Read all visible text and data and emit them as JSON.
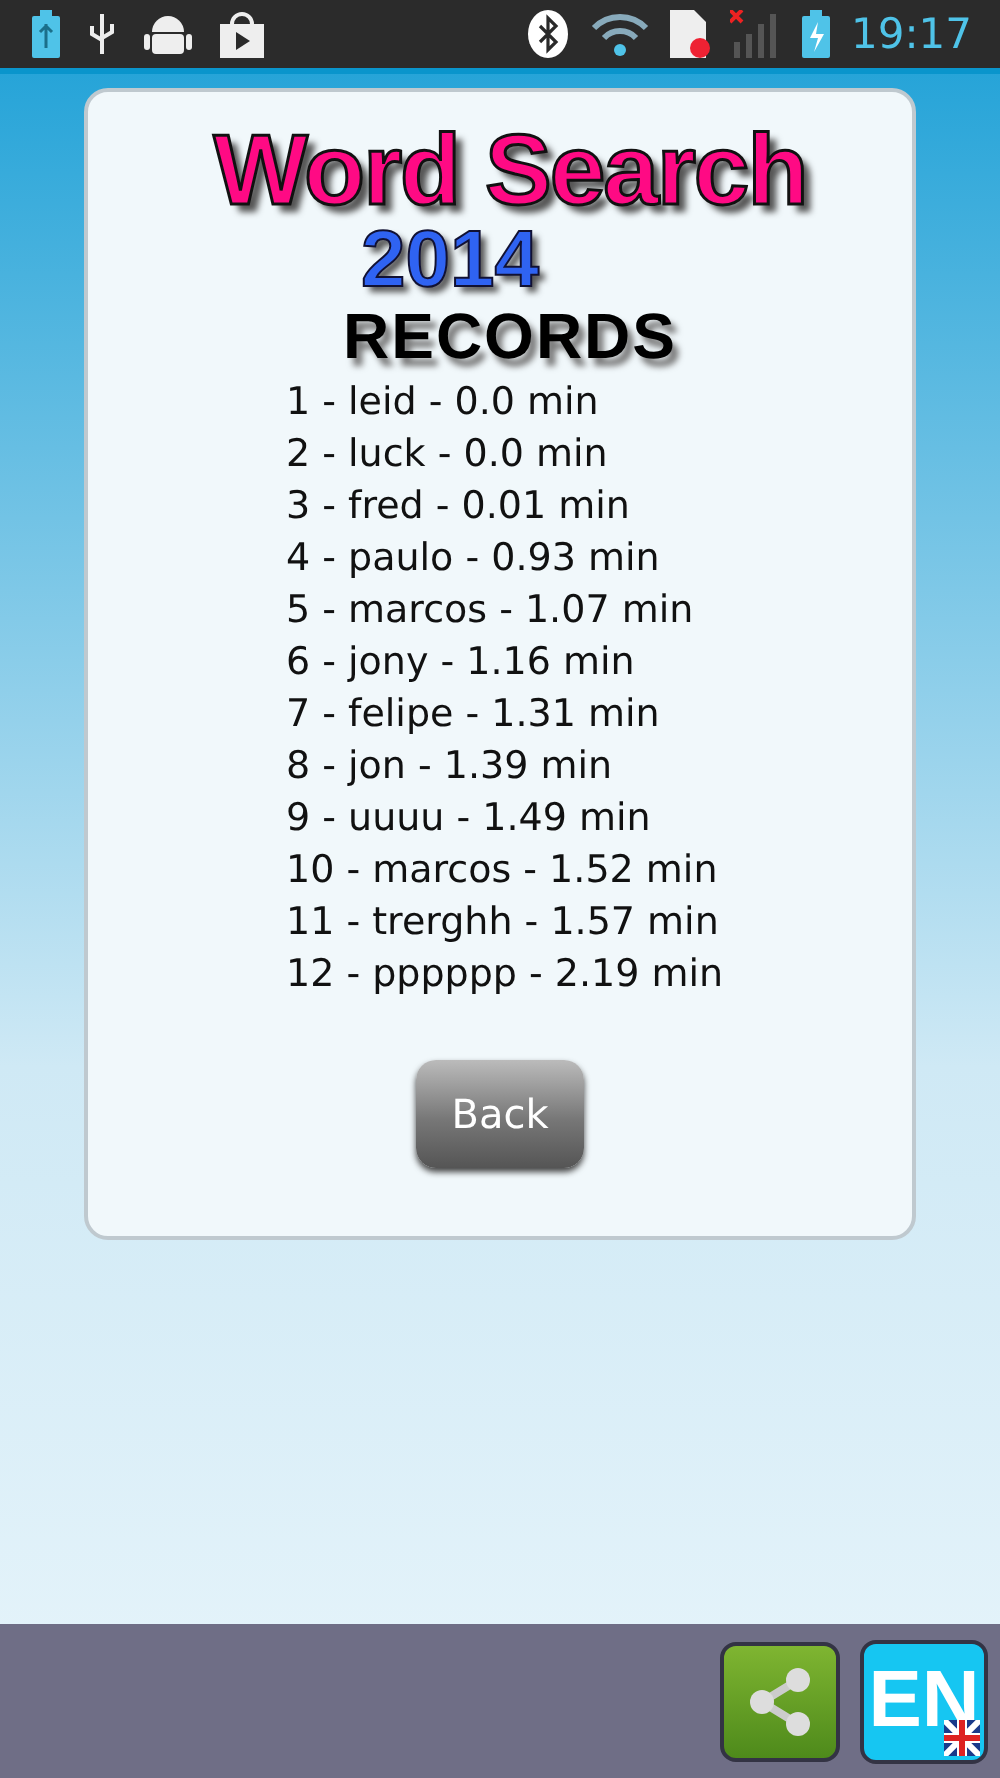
{
  "status_bar": {
    "time": "19:17"
  },
  "title": {
    "line_1": "Word Search",
    "line_2": "2014"
  },
  "heading": "RECORDS",
  "records": [
    "1 - leid - 0.0 min",
    "2 - luck - 0.0 min",
    "3 - fred - 0.01 min",
    "4 - paulo - 0.93 min",
    "5 - marcos - 1.07 min",
    "6 - jony - 1.16 min",
    "7 - felipe - 1.31 min",
    "8 - jon - 1.39 min",
    "9 - uuuu - 1.49 min",
    "10 - marcos - 1.52 min",
    "11 - trerghh - 1.57 min",
    "12 - pppppp - 2.19 min"
  ],
  "back_button": "Back",
  "language_button": "EN"
}
